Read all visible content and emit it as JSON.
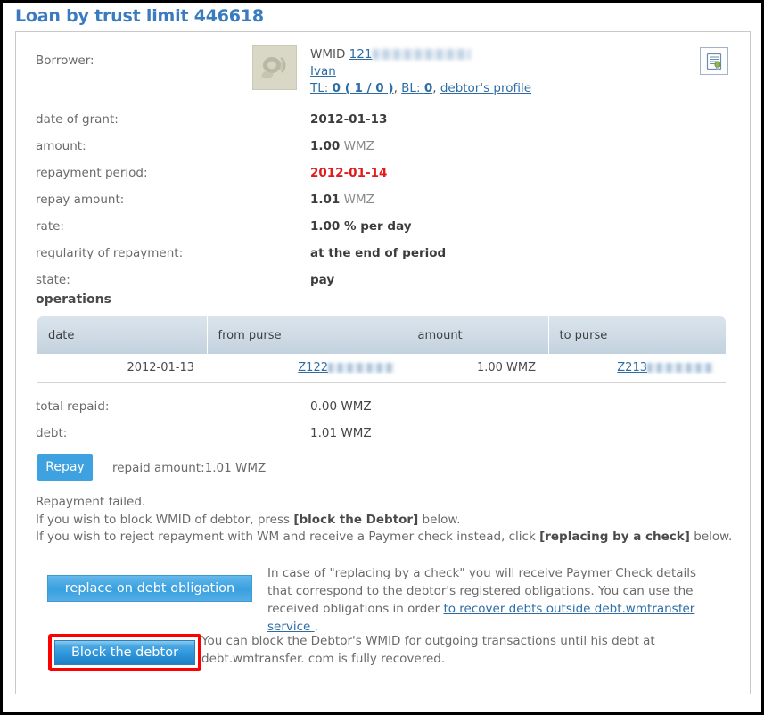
{
  "page": {
    "title": "Loan by trust limit 446618"
  },
  "borrower": {
    "label": "Borrower:",
    "avatar_icon": "avatar-placeholder-icon",
    "wmid_prefix": "WMID",
    "wmid_visible": "121",
    "name": "Ivan",
    "tl_label": "TL:",
    "tl_value": "0 ( 1 / 0 )",
    "separator_1": ",",
    "bl_label": "BL:",
    "bl_value": "0",
    "separator_2": ",",
    "profile_link": "debtor's profile",
    "certificate_icon": "certificate-document-icon"
  },
  "details": [
    {
      "label": "date of grant:",
      "value": "2012-01-13",
      "unit": "",
      "accent": "normal"
    },
    {
      "label": "amount:",
      "value": "1.00",
      "unit": "WMZ",
      "accent": "normal"
    },
    {
      "label": "repayment period:",
      "value": "2012-01-14",
      "unit": "",
      "accent": "red"
    },
    {
      "label": "repay amount:",
      "value": "1.01",
      "unit": "WMZ",
      "accent": "normal"
    },
    {
      "label": "rate:",
      "value": "1.00 % per day",
      "unit": "",
      "accent": "normal"
    },
    {
      "label": "regularity of repayment:",
      "value": "at the end of period",
      "unit": "",
      "accent": "normal"
    },
    {
      "label": "state:",
      "value": "pay",
      "unit": "",
      "accent": "normal"
    }
  ],
  "operations": {
    "heading": "operations",
    "columns": [
      "date",
      "from purse",
      "amount",
      "to purse"
    ],
    "rows": [
      {
        "date": "2012-01-13",
        "from_purse": "Z122",
        "amount": "1.00 WMZ",
        "to_purse": "Z213"
      }
    ]
  },
  "totals": [
    {
      "label": "total repaid:",
      "value": "0.00 WMZ"
    },
    {
      "label": "debt:",
      "value": "1.01 WMZ"
    }
  ],
  "repay": {
    "button_label": "Repay",
    "note": "repaid amount:1.01 WMZ"
  },
  "failure_message": {
    "line1": "Repayment failed.",
    "line2_a": "If you wish to block WMID of debtor, press ",
    "line2_b": "[block the Debtor]",
    "line2_c": " below.",
    "line3_a": "If you wish to reject repayment with WM and receive a Paymer check instead, click ",
    "line3_b": "[replacing by a check]",
    "line3_c": " below."
  },
  "actions": {
    "replace_button_label": "replace on debt obligation",
    "replace_note_a": "In case of \"replacing by a check\" you will receive Paymer Check details that correspond to the debtor's registered obligations. You can use the received obligations in order ",
    "replace_note_link": "to recover debts outside debt.wmtransfer service ",
    "replace_note_b": ".",
    "block_button_label": "Block the debtor",
    "block_note": "You can block the Debtor's WMID for outgoing transactions until his debt at debt.wmtransfer. com is fully recovered."
  },
  "colors": {
    "title": "#3a7bbf",
    "link": "#2e6da4",
    "alert": "#ff0000",
    "primary_button": "#3ea2e0",
    "highlight_box": "#ff0000"
  }
}
